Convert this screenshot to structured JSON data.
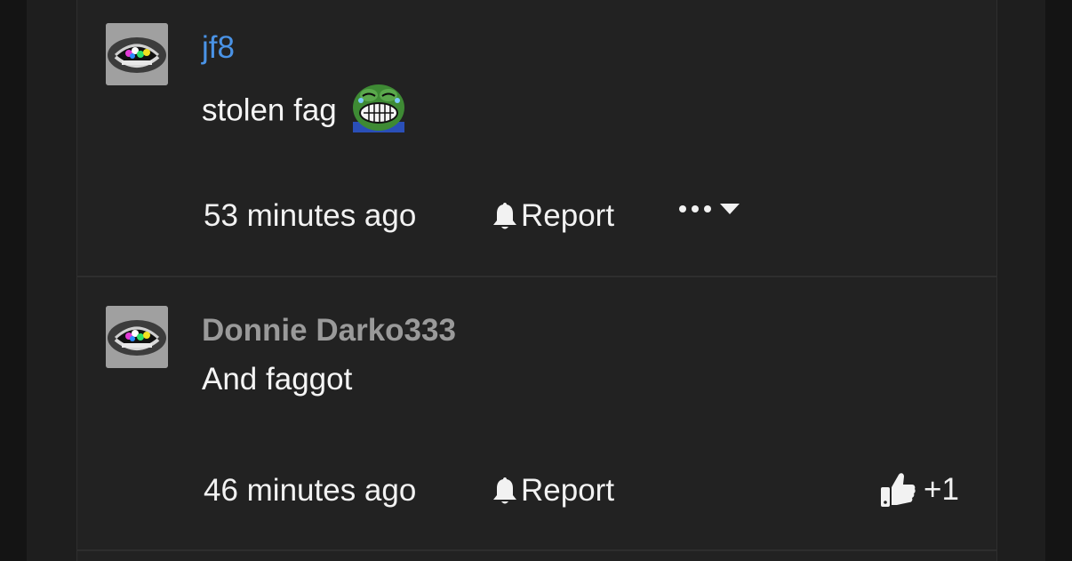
{
  "comments": [
    {
      "username": "jf8",
      "text": "stolen fag",
      "time": "53 minutes ago",
      "report_label": "Report",
      "avatar_icon": "lips-avatar",
      "emoji_icon": "pepe-laughing-crying-emoji",
      "username_color": "#4a93e6"
    },
    {
      "username": "Donnie Darko333",
      "text": "And faggot",
      "time": "46 minutes ago",
      "report_label": "Report",
      "avatar_icon": "lips-avatar",
      "like_count": "+1",
      "username_color": "#9a9a9a"
    }
  ]
}
